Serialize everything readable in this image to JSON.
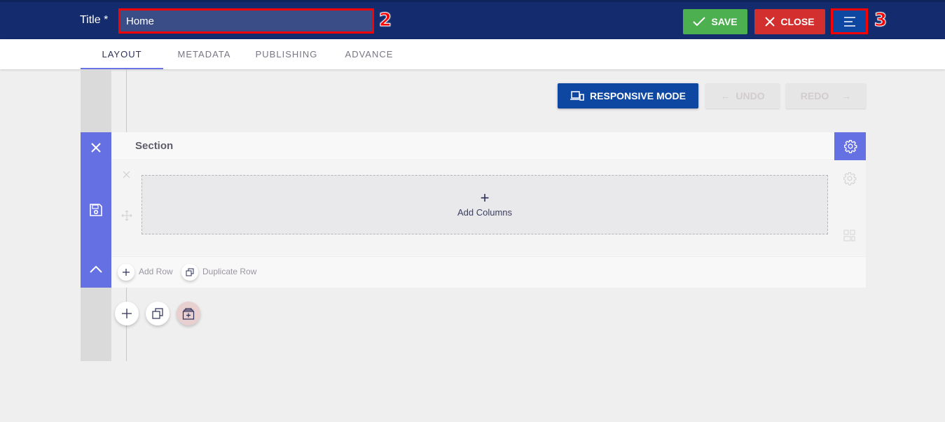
{
  "header": {
    "title_label": "Title *",
    "title_value": "Home",
    "badge_title": "2",
    "badge_menu": "3",
    "save_label": "SAVE",
    "close_label": "CLOSE"
  },
  "tabs": [
    {
      "label": "LAYOUT",
      "active": true
    },
    {
      "label": "METADATA",
      "active": false
    },
    {
      "label": "PUBLISHING",
      "active": false
    },
    {
      "label": "ADVANCE",
      "active": false
    }
  ],
  "toolbar": {
    "responsive_label": "RESPONSIVE MODE",
    "undo_label": "UNDO",
    "redo_label": "REDO"
  },
  "section": {
    "title": "Section",
    "add_columns_label": "Add Columns",
    "add_columns_icon": "+",
    "add_row_label": "Add Row",
    "duplicate_row_label": "Duplicate Row"
  },
  "colors": {
    "topbar": "#142c6e",
    "save": "#4caf50",
    "close": "#d32f2f",
    "primary": "#0d47a1",
    "section_accent": "#6570e3"
  }
}
